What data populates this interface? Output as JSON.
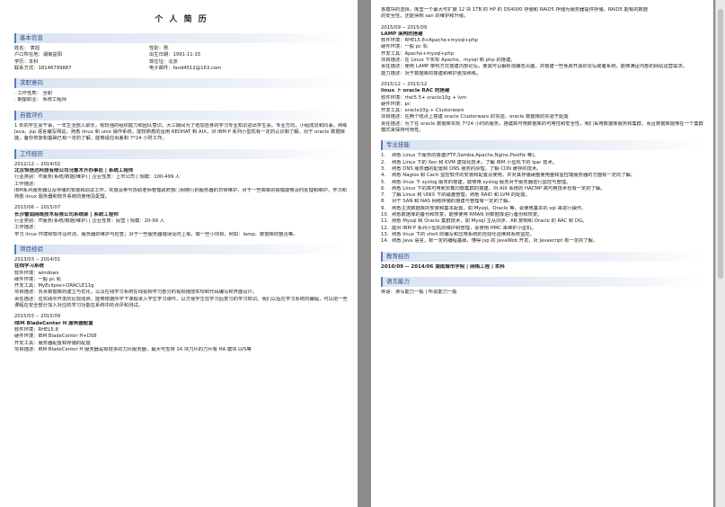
{
  "left": {
    "title": "个 人 简 历",
    "basic": {
      "heading": "基本信息",
      "rows": [
        [
          "姓名：  袁旭",
          "性别：男"
        ],
        [
          "户口所在地：湖南益阳",
          "出生日期：1991-11-15"
        ],
        [
          "学历：本科",
          "现住址：北京"
        ],
        [
          "联系方式：18146799887",
          "电子邮件：fand4512@163.com"
        ]
      ]
    },
    "intent": {
      "heading": "求职意向",
      "items": [
        "· 工作性质：     全职",
        "· 期望职业：     系统工程师"
      ]
    },
    "self": {
      "heading": "自我评价",
      "text": "1 年的学生会干事，一年生活部入职长，有较强的组织能力和团队意识。大三期间为了增加自身的学习专业知识进出学生会。专业方向，小组成员和同事。熟练 Java、jsp 语言编写网站，熟悉 linux 和 unix 操作系统，能较熟悉的运用 REDHAT 和 AIX，对 IBM P 系列小型机有一定的认识和了解，对于 oracle 数据库能，备份恢复和基础已有一定的了解，能够适应出差和 7*24 小时工作。"
    },
    "work": {
      "heading": "工作经历",
      "entries": [
        {
          "date": "2012/12 -- 2014/02",
          "company": "北京恒信达科技有限公司乌鲁木齐办事处  |  系统工程师",
          "meta": "行业类别：IT服务(系统/数据/维护)  |  企业性质：上市公司  |  规模：100-499 人",
          "duty_label": "工作描述：",
          "desc": "IBM系列服务器以及存储的安装和调试工作，实施及参与协助老师管理政府部门网络行的服务器的日常维护，对于一些简单的报错能够及时处理和维护，学习和熟悉 linux 服务器和软件系统的使用及配置。"
        },
        {
          "date": "2015/06 -- 2015/07",
          "company": "长沙雷润网络技术有限公司系统部  |  系统工程师",
          "meta": "行业类别：IT服务(系统/数据/维护)  |  企业性质：民营  |  规模：20-99 人",
          "duty_label": "工作描述：",
          "desc": "学习 linux 环境和软件及时改，服务器的维护与检查；对于一些服务器错误及时上报，做一些小项目，例如：lamp、数据库的整合等。"
        }
      ]
    },
    "project": {
      "heading": "项目经验",
      "entries": [
        {
          "date": "2013/03 -- 2014/01",
          "name": "在线学习系统",
          "lines": [
            "软件环境：windows",
            "硬件环境：一般 pc 机",
            "开发工具：MyEclipse+ORACLE11g",
            "项目描述：负责数据库的建立与优化，以及在线学习系统在线视频学习部分的视频播放实现和代码编写和界面设计。",
            "责任描述：在实践中开发的比较成熟，能够根据所学下课题录入学生学习课件，以方便学生在学习后复习的学习知识。我们以后在学习系统的编程，可以把一些课程在安全部分加入对应的学习功能在系统中的点评和测试。"
          ]
        },
        {
          "date": "2015/03 -- 2015/09",
          "name": "IBM BladeCenter H 服务器配置",
          "lines": [
            "软件环境：RHEL5.8",
            "硬件环境：IBM BladeCenter H+DS8",
            "开发工具：服务器配置和存储的配置",
            "项目描述：IBM BladeCenter H 服务器是有很多的刀片服务器，最大可支持 14 块刀片的刀片有 HA 模块 LVS等"
          ]
        }
      ]
    }
  },
  "right": {
    "intro_lines": [
      "各模块的选择，库里一个最大可扩展 12 块 1TB 的 HP 的 DS4000 存储和 RAID5 存储为服务器提供存储，RAID5 能有的数据",
      "的安全性，还能得到 san 的维护和升级。"
    ],
    "projects": [
      {
        "date": "2015/09 -- 2015/09",
        "name": "LAMP 架构的搭建",
        "lines": [
          "软件环境：RHEL5.8+Apache+mysql+php",
          "硬件环境：一般 pc 机",
          "开发工具：Apache+mysql+php",
          "项目描述：在 Linux 下实现 Apache、mysql 和 php 的搭建。",
          "责任描述：使用 LAMP 架构方式搭建内部论坛，使其可以解析动静态页面，并搭建一些免费开源的论坛或者系统，能够满足内部的网站运营需求。",
          "能力描述：对于数据库的搭建和维护更加熟练。"
        ]
      },
      {
        "date": "2015/12 -- 2015/12",
        "name": "linux 下 oracle RAC 的搭建",
        "lines": [
          "软件环境：rhel5.5+ oracle10g + lvm",
          "硬件环境：pc",
          "开发工具：oracle10g + Clusterware",
          "项目描述：在两个结点上搭建 oracle Clusterware 的实验，oracle 数据库的实验于配置",
          "责任描述：为了在 oracle 数据库实现 7*24 小时的服务，搭建高可用数据库的可用性和安全性，我们采用数据库服务和集群，而且数据库能够在一个集群模式来保持可用性。"
        ]
      }
    ],
    "skills": {
      "heading": "专业技能",
      "items": [
        "熟悉 Linux 下服务的搭建(FTP,Samba,Apache,Nginx,Postfix 等)。",
        "熟悉 Linux 下的 Xen 和 KVM 虚拟化技术，了解 IBM 小型机下的 lpar 技术。",
        "熟悉 DNS 服务器的配置和 DNS 服务的原理，了解 CDN 缓存的技术。",
        "熟悉 Nagios 和 Cacti 监控软件的安装和配置及使用，并对其存储硬盘使用量和监控端服务器的方面有一定的了解。",
        "熟悉 linux 下 syslog 服务的搭建，能够用 syslog 服务对于服务器进行监控与管理。",
        "熟悉 Linux 下的高可用和负载均衡集群的搭建，对 AIX 系统的 HACMP 高可用技术也有一定的了解。",
        "了解 Linux 和 UNIX 下的磁盘管理，熟悉 RAID 和 LVM 的配置。",
        "对于 SAN 和 NAS 网络存储的搭建与管理有一定的了解。",
        "熟悉主流数据库的安装和基本配置，如 Mysql、Oracle 等，会使用基本的 sql 来进行操作。",
        "熟悉数据库的备份和恢复，能够使用 RMAN 对数据库进行备份和恢复。",
        "熟悉 Mysql 和 Oracle 集群技术，如 Mysql 主从同步、AB 复制和 Oracle 的 RAC 和 DG。",
        "能对 IBM P 系列小型机的维护和管理，会使用 HMC 来维护小型机。",
        "熟悉 linux 下的 shell 的编写和应用系统的自动化运维和系统监控。",
        "熟悉 Java 语言，有一定的编程基础，懂得 jsp 的 JavaWeb 开发，对 Javascript 有一定的了解。"
      ]
    },
    "education": {
      "heading": "教育经历",
      "line": "2010/09 -- 2014/06  湖南城市学院  |  网络工程  |  本科"
    },
    "language": {
      "heading": "语言能力",
      "line": "英语：读写能力一般  |  听说能力一般"
    }
  }
}
